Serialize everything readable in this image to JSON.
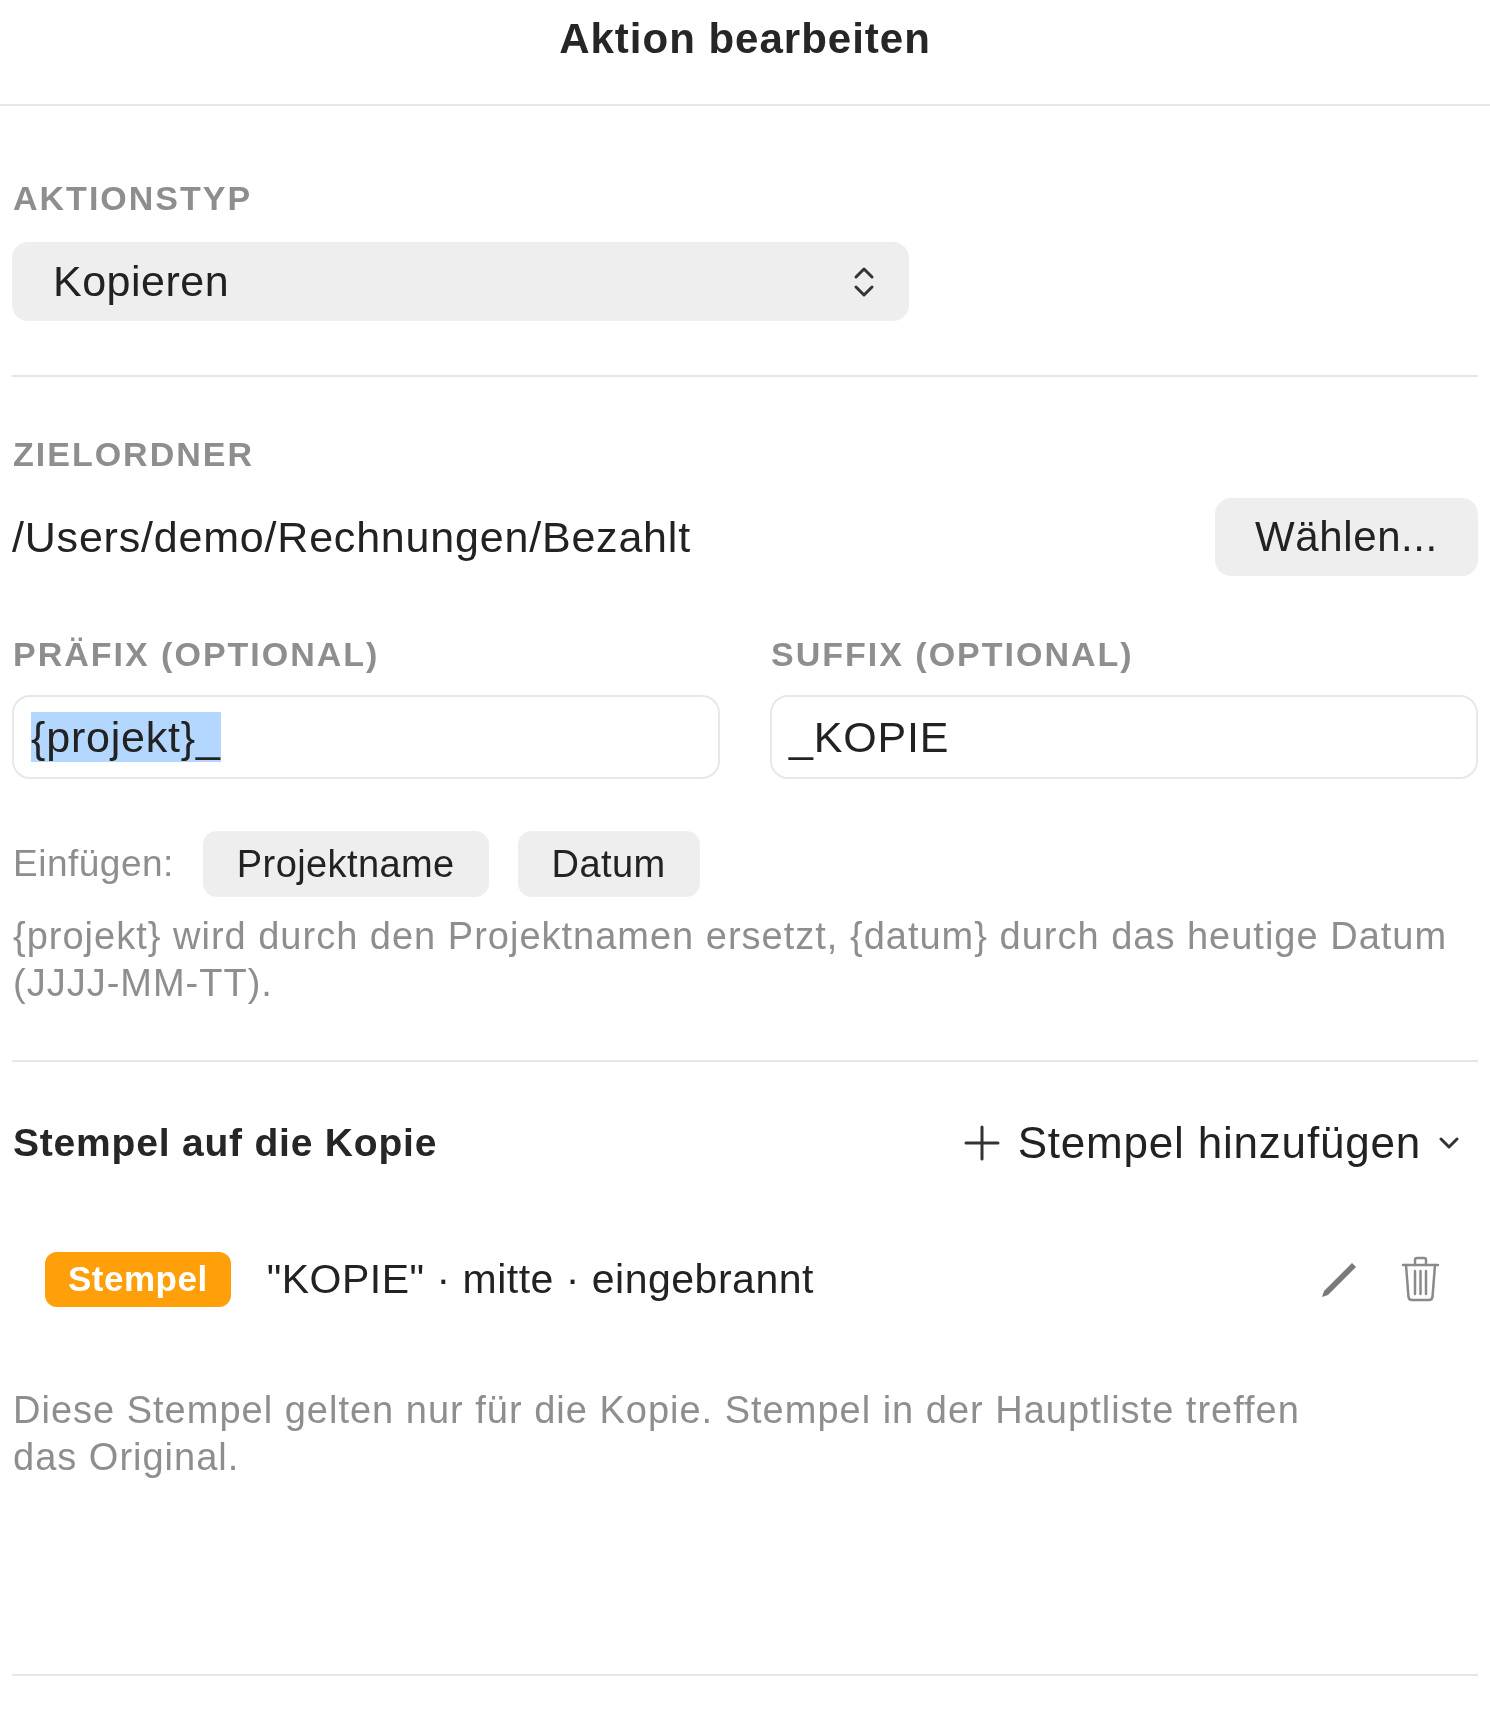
{
  "window": {
    "title": "Aktion bearbeiten"
  },
  "action_type": {
    "label": "AKTIONSTYP",
    "value": "Kopieren"
  },
  "target_folder": {
    "label": "ZIELORDNER",
    "path": "/Users/demo/Rechnungen/Bezahlt",
    "button": "Wählen..."
  },
  "prefix": {
    "label": "PRÄFIX (OPTIONAL)",
    "value": "{projekt}_",
    "text_selected": true
  },
  "suffix": {
    "label": "SUFFIX (OPTIONAL)",
    "value": "_KOPIE",
    "text_selected": false
  },
  "insert": {
    "label": "Einfügen:",
    "tokens": [
      "Projektname",
      "Datum"
    ]
  },
  "hint": "{projekt} wird durch den Projektnamen ersetzt, {datum} durch das heutige Datum (JJJJ-MM-TT).",
  "stamps": {
    "title": "Stempel auf die Kopie",
    "add_button": "Stempel hinzufügen",
    "items": [
      {
        "badge": "Stempel",
        "description": "\"KOPIE\" · mitte · eingebrannt"
      }
    ],
    "note": "Diese Stempel gelten nur für die Kopie. Stempel in der Hauptliste treffen das Original."
  }
}
